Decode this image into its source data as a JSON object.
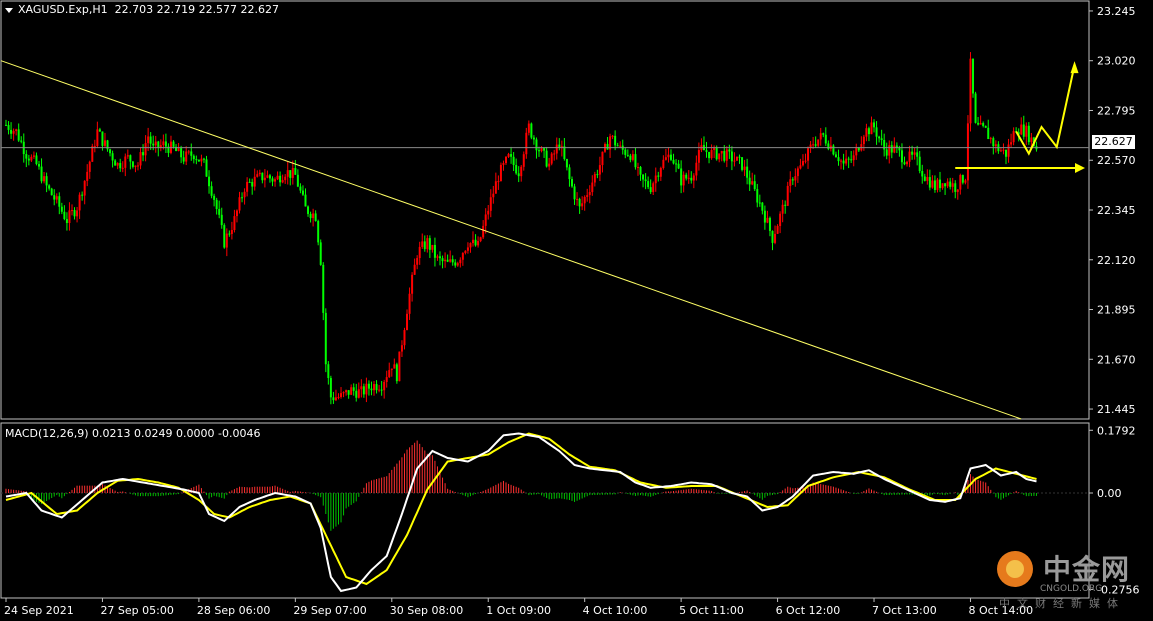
{
  "header": {
    "symbol_line": "XAGUSD.Exp,H1  22.703 22.719 22.577 22.627"
  },
  "macd_header": "MACD(12,26,9) 0.0213 0.0249 0.0000 -0.0046",
  "current_price_label": "22.627",
  "watermark": {
    "cn": "中金网",
    "en": "CNGOLD.ORG",
    "sub": "中文财经新媒体"
  },
  "colors": {
    "background": "#000000",
    "up_candle": "#ff0000",
    "down_candle": "#00ff00",
    "trendline": "#ffff66",
    "arrows": "#ffff00",
    "macd_line": "#ffffff",
    "signal_line": "#ffff00",
    "hist_pos": "#ff3030",
    "hist_neg": "#00c000",
    "axis": "#c0c0c0"
  },
  "chart_data": [
    {
      "type": "candlestick",
      "title": "XAGUSD.Exp,H1",
      "y_ticks": [
        "23.245",
        "23.020",
        "22.795",
        "22.570",
        "22.345",
        "22.120",
        "21.895",
        "21.670",
        "21.445"
      ],
      "ylim": [
        21.4,
        23.29
      ],
      "x_ticks": [
        "24 Sep 2021",
        "27 Sep 05:00",
        "28 Sep 06:00",
        "29 Sep 07:00",
        "30 Sep 08:00",
        "1 Oct 09:00",
        "4 Oct 10:00",
        "5 Oct 11:00",
        "6 Oct 12:00",
        "7 Oct 13:00",
        "8 Oct 14:00"
      ],
      "current_price": 22.627,
      "price_path": [
        [
          0,
          22.73
        ],
        [
          4,
          22.7
        ],
        [
          8,
          22.6
        ],
        [
          12,
          22.55
        ],
        [
          16,
          22.45
        ],
        [
          20,
          22.38
        ],
        [
          24,
          22.3
        ],
        [
          28,
          22.36
        ],
        [
          32,
          22.52
        ],
        [
          36,
          22.7
        ],
        [
          40,
          22.62
        ],
        [
          44,
          22.55
        ],
        [
          48,
          22.58
        ],
        [
          52,
          22.55
        ],
        [
          56,
          22.68
        ],
        [
          58,
          22.62
        ],
        [
          62,
          22.64
        ],
        [
          66,
          22.62
        ],
        [
          70,
          22.58
        ],
        [
          74,
          22.6
        ],
        [
          78,
          22.55
        ],
        [
          82,
          22.4
        ],
        [
          86,
          22.2
        ],
        [
          90,
          22.3
        ],
        [
          94,
          22.45
        ],
        [
          98,
          22.48
        ],
        [
          102,
          22.5
        ],
        [
          106,
          22.48
        ],
        [
          110,
          22.52
        ],
        [
          114,
          22.5
        ],
        [
          118,
          22.35
        ],
        [
          122,
          22.32
        ],
        [
          124,
          22.12
        ],
        [
          126,
          21.65
        ],
        [
          128,
          21.5
        ],
        [
          132,
          21.5
        ],
        [
          136,
          21.53
        ],
        [
          140,
          21.52
        ],
        [
          144,
          21.55
        ],
        [
          148,
          21.56
        ],
        [
          152,
          21.65
        ],
        [
          154,
          21.6
        ],
        [
          158,
          21.9
        ],
        [
          162,
          22.15
        ],
        [
          166,
          22.2
        ],
        [
          170,
          22.12
        ],
        [
          174,
          22.1
        ],
        [
          178,
          22.12
        ],
        [
          182,
          22.2
        ],
        [
          186,
          22.18
        ],
        [
          190,
          22.35
        ],
        [
          194,
          22.5
        ],
        [
          198,
          22.58
        ],
        [
          202,
          22.52
        ],
        [
          206,
          22.72
        ],
        [
          210,
          22.62
        ],
        [
          214,
          22.55
        ],
        [
          218,
          22.65
        ],
        [
          222,
          22.48
        ],
        [
          226,
          22.35
        ],
        [
          230,
          22.45
        ],
        [
          234,
          22.55
        ],
        [
          238,
          22.68
        ],
        [
          242,
          22.62
        ],
        [
          246,
          22.6
        ],
        [
          250,
          22.48
        ],
        [
          254,
          22.45
        ],
        [
          258,
          22.55
        ],
        [
          262,
          22.6
        ],
        [
          266,
          22.48
        ],
        [
          270,
          22.5
        ],
        [
          274,
          22.62
        ],
        [
          278,
          22.6
        ],
        [
          282,
          22.6
        ],
        [
          286,
          22.58
        ],
        [
          290,
          22.55
        ],
        [
          294,
          22.45
        ],
        [
          298,
          22.35
        ],
        [
          302,
          22.22
        ],
        [
          306,
          22.35
        ],
        [
          310,
          22.5
        ],
        [
          314,
          22.55
        ],
        [
          318,
          22.65
        ],
        [
          322,
          22.68
        ],
        [
          326,
          22.62
        ],
        [
          330,
          22.55
        ],
        [
          334,
          22.58
        ],
        [
          338,
          22.7
        ],
        [
          342,
          22.72
        ],
        [
          346,
          22.62
        ],
        [
          350,
          22.62
        ],
        [
          354,
          22.58
        ],
        [
          358,
          22.58
        ],
        [
          362,
          22.5
        ],
        [
          366,
          22.45
        ],
        [
          370,
          22.48
        ],
        [
          374,
          22.45
        ],
        [
          378,
          22.5
        ],
        [
          380,
          23.0
        ],
        [
          382,
          22.72
        ],
        [
          386,
          22.7
        ],
        [
          390,
          22.63
        ],
        [
          394,
          22.6
        ],
        [
          398,
          22.72
        ],
        [
          402,
          22.7
        ],
        [
          406,
          22.627
        ]
      ]
    },
    {
      "type": "line",
      "title": "MACD(12,26,9)",
      "y_ticks": [
        "0.1792",
        "0.00",
        "-0.2756"
      ],
      "ylim": [
        -0.3,
        0.2
      ],
      "series": [
        {
          "name": "MACD",
          "points": [
            [
              0,
              -0.01
            ],
            [
              8,
              0.0
            ],
            [
              14,
              -0.05
            ],
            [
              22,
              -0.07
            ],
            [
              30,
              -0.02
            ],
            [
              38,
              0.03
            ],
            [
              46,
              0.04
            ],
            [
              54,
              0.03
            ],
            [
              62,
              0.02
            ],
            [
              70,
              0.01
            ],
            [
              76,
              0.0
            ],
            [
              80,
              -0.06
            ],
            [
              86,
              -0.08
            ],
            [
              92,
              -0.04
            ],
            [
              98,
              -0.02
            ],
            [
              106,
              0.0
            ],
            [
              114,
              -0.01
            ],
            [
              120,
              -0.03
            ],
            [
              124,
              -0.1
            ],
            [
              128,
              -0.24
            ],
            [
              132,
              -0.28
            ],
            [
              138,
              -0.27
            ],
            [
              144,
              -0.22
            ],
            [
              150,
              -0.18
            ],
            [
              156,
              -0.06
            ],
            [
              162,
              0.07
            ],
            [
              168,
              0.12
            ],
            [
              174,
              0.1
            ],
            [
              182,
              0.09
            ],
            [
              190,
              0.12
            ],
            [
              196,
              0.165
            ],
            [
              202,
              0.17
            ],
            [
              210,
              0.16
            ],
            [
              218,
              0.12
            ],
            [
              224,
              0.08
            ],
            [
              230,
              0.07
            ],
            [
              236,
              0.065
            ],
            [
              242,
              0.06
            ],
            [
              248,
              0.03
            ],
            [
              254,
              0.015
            ],
            [
              262,
              0.02
            ],
            [
              270,
              0.03
            ],
            [
              278,
              0.025
            ],
            [
              286,
              0.0
            ],
            [
              292,
              -0.01
            ],
            [
              298,
              -0.05
            ],
            [
              304,
              -0.04
            ],
            [
              310,
              -0.01
            ],
            [
              318,
              0.05
            ],
            [
              326,
              0.06
            ],
            [
              334,
              0.055
            ],
            [
              340,
              0.065
            ],
            [
              346,
              0.04
            ],
            [
              352,
              0.02
            ],
            [
              358,
              0.0
            ],
            [
              364,
              -0.02
            ],
            [
              370,
              -0.025
            ],
            [
              376,
              -0.015
            ],
            [
              380,
              0.07
            ],
            [
              386,
              0.08
            ],
            [
              392,
              0.05
            ],
            [
              398,
              0.06
            ],
            [
              402,
              0.04
            ],
            [
              406,
              0.033
            ]
          ]
        },
        {
          "name": "Signal",
          "points": [
            [
              0,
              -0.02
            ],
            [
              10,
              0.0
            ],
            [
              20,
              -0.06
            ],
            [
              28,
              -0.05
            ],
            [
              36,
              0.0
            ],
            [
              44,
              0.035
            ],
            [
              52,
              0.04
            ],
            [
              60,
              0.03
            ],
            [
              68,
              0.015
            ],
            [
              76,
              -0.02
            ],
            [
              82,
              -0.06
            ],
            [
              88,
              -0.07
            ],
            [
              96,
              -0.04
            ],
            [
              104,
              -0.02
            ],
            [
              112,
              -0.01
            ],
            [
              120,
              -0.03
            ],
            [
              126,
              -0.12
            ],
            [
              134,
              -0.24
            ],
            [
              142,
              -0.26
            ],
            [
              150,
              -0.22
            ],
            [
              158,
              -0.12
            ],
            [
              166,
              0.01
            ],
            [
              174,
              0.09
            ],
            [
              182,
              0.1
            ],
            [
              190,
              0.11
            ],
            [
              198,
              0.145
            ],
            [
              206,
              0.17
            ],
            [
              214,
              0.155
            ],
            [
              222,
              0.11
            ],
            [
              230,
              0.075
            ],
            [
              240,
              0.065
            ],
            [
              250,
              0.03
            ],
            [
              260,
              0.015
            ],
            [
              270,
              0.02
            ],
            [
              280,
              0.02
            ],
            [
              290,
              -0.01
            ],
            [
              300,
              -0.04
            ],
            [
              308,
              -0.035
            ],
            [
              316,
              0.02
            ],
            [
              326,
              0.045
            ],
            [
              336,
              0.06
            ],
            [
              346,
              0.045
            ],
            [
              356,
              0.01
            ],
            [
              366,
              -0.02
            ],
            [
              374,
              -0.02
            ],
            [
              382,
              0.04
            ],
            [
              390,
              0.07
            ],
            [
              398,
              0.055
            ],
            [
              406,
              0.04
            ]
          ]
        }
      ]
    }
  ]
}
